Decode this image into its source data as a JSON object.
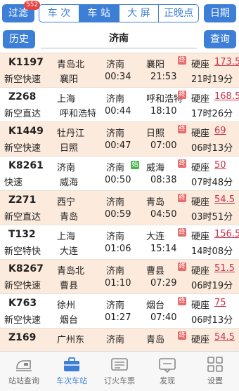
{
  "header": {
    "filter_label": "过滤",
    "filter_badge": "552",
    "segments": [
      {
        "label": "车 次",
        "active": false
      },
      {
        "label": "车 站",
        "active": true
      },
      {
        "label": "大 屏",
        "active": false
      },
      {
        "label": "正晚点",
        "active": false
      }
    ],
    "date_label": "日期"
  },
  "search": {
    "history_label": "历史",
    "query_value": "济南",
    "submit_label": "查询"
  },
  "trains": [
    {
      "no": "K1197",
      "type": "新空快速",
      "from": "青岛北",
      "to": "襄阳",
      "station": "济南",
      "arr": "00:34",
      "end_station": "襄阳",
      "end_time": "21:53",
      "terminal": "终",
      "seat": "硬座",
      "price": "173.5",
      "duration": "21时19分"
    },
    {
      "no": "Z268",
      "type": "新空直达",
      "from": "上海",
      "to": "呼和浩特",
      "station": "济南",
      "arr": "00:44",
      "end_station": "呼和浩特",
      "end_time": "18:10",
      "terminal": "终",
      "seat": "硬座",
      "price": "168.5",
      "duration": "17时26分"
    },
    {
      "no": "K1449",
      "type": "新空快速",
      "from": "牡丹江",
      "to": "日照",
      "station": "济南",
      "arr": "00:47",
      "end_station": "日照",
      "end_time": "07:00",
      "terminal": "终",
      "seat": "硬座",
      "price": "69",
      "duration": "06时13分"
    },
    {
      "no": "K8261",
      "type": "快速",
      "from": "济南",
      "to": "威海",
      "station": "济南",
      "arr": "00:50",
      "end_station": "威海",
      "end_time": "08:38",
      "origin": "始",
      "terminal": "终",
      "seat": "硬座",
      "price": "50",
      "duration": "07时48分"
    },
    {
      "no": "Z271",
      "type": "新空直达",
      "from": "西宁",
      "to": "青岛",
      "station": "济南",
      "arr": "00:59",
      "end_station": "青岛",
      "end_time": "04:50",
      "terminal": "终",
      "seat": "硬座",
      "price": "54.5",
      "duration": "03时51分"
    },
    {
      "no": "T132",
      "type": "新空特快",
      "from": "上海",
      "to": "大连",
      "station": "济南",
      "arr": "01:06",
      "end_station": "大连",
      "end_time": "15:14",
      "terminal": "终",
      "seat": "硬座",
      "price": "156.5",
      "duration": "14时08分"
    },
    {
      "no": "K8267",
      "type": "新空快速",
      "from": "青岛北",
      "to": "曹县",
      "station": "济南",
      "arr": "01:10",
      "end_station": "曹县",
      "end_time": "07:29",
      "terminal": "终",
      "seat": "硬座",
      "price": "51.5",
      "duration": "06时19分"
    },
    {
      "no": "K763",
      "type": "新空快速",
      "from": "徐州",
      "to": "烟台",
      "station": "济南",
      "arr": "01:27",
      "end_station": "烟台",
      "end_time": "07:40",
      "terminal": "终",
      "seat": "硬座",
      "price": "75",
      "duration": "06时13分"
    },
    {
      "no": "Z169",
      "type": "",
      "from": "广州东",
      "to": "",
      "station": "济南",
      "arr": "",
      "end_station": "青岛",
      "end_time": "",
      "terminal": "终",
      "seat": "硬座",
      "price": "54.5",
      "duration": ""
    }
  ],
  "tabs": [
    {
      "label": "站站查询",
      "icon": "train-icon",
      "active": false
    },
    {
      "label": "车次车站",
      "icon": "briefcase-icon",
      "active": true
    },
    {
      "label": "订火车票",
      "icon": "ticket-icon",
      "active": false
    },
    {
      "label": "发现",
      "icon": "discover-icon",
      "active": false
    },
    {
      "label": "设置",
      "icon": "settings-grid-icon",
      "active": false
    }
  ],
  "colors": {
    "accent": "#3d7fd6",
    "row_highlight": "#fcebdc",
    "price": "#c8314a",
    "terminal_tag": "#e86a6a",
    "origin_tag": "#45b24a"
  }
}
